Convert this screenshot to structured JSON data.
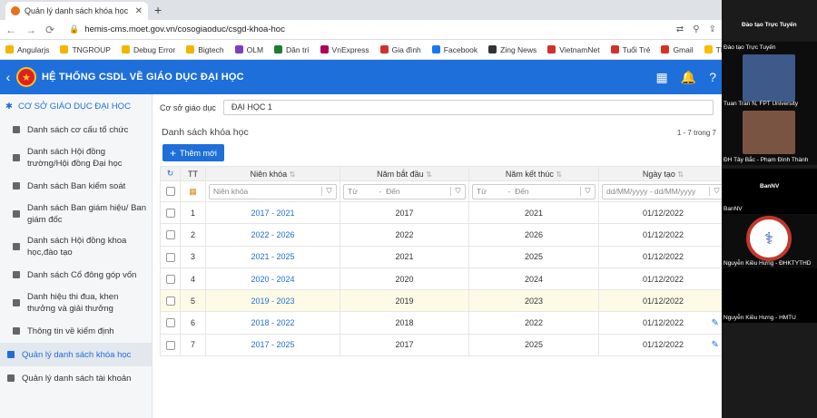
{
  "browser": {
    "tab_title": "Quản lý danh sách khóa học - H",
    "url": "hemis-cms.moet.gov.vn/cosogiaoduc/csgd-khoa-hoc",
    "bookmarks": [
      {
        "label": "Angularjs",
        "color": "#f4b400"
      },
      {
        "label": "TNGROUP",
        "color": "#f4b400"
      },
      {
        "label": "Debug Error",
        "color": "#f4b400"
      },
      {
        "label": "Bigtech",
        "color": "#f4b400"
      },
      {
        "label": "OLM",
        "color": "#7b3fbf"
      },
      {
        "label": "Dân trí",
        "color": "#1a7d2f"
      },
      {
        "label": "VnExpress",
        "color": "#b0005a"
      },
      {
        "label": "Gia đình",
        "color": "#d32f2f"
      },
      {
        "label": "Facebook",
        "color": "#1877f2"
      },
      {
        "label": "Zing News",
        "color": "#333333"
      },
      {
        "label": "VietnamNet",
        "color": "#d32f2f"
      },
      {
        "label": "Tuổi Trẻ",
        "color": "#d32f2f"
      },
      {
        "label": "Gmail",
        "color": "#d93025"
      },
      {
        "label": "TEAM",
        "color": "#fbbc04"
      }
    ]
  },
  "header": {
    "title": "HỆ THỐNG CSDL VỀ GIÁO DỤC ĐẠI HỌC",
    "color": "#1e6fd9"
  },
  "sidebar": {
    "heading": "CƠ SỞ GIÁO DỤC ĐẠI HỌC",
    "items": [
      {
        "label": "Danh sách cơ cấu tổ chức",
        "lines": 1
      },
      {
        "label": "Danh sách Hội đồng trường/Hội đồng Đại học",
        "lines": 2
      },
      {
        "label": "Danh sách Ban kiểm soát",
        "lines": 1
      },
      {
        "label": "Danh sách Ban giám hiệu/ Ban giám đốc",
        "lines": 2
      },
      {
        "label": "Danh sách Hội đồng khoa học,đào tạo",
        "lines": 2
      },
      {
        "label": "Danh sách Cổ đông góp vốn",
        "lines": 1
      },
      {
        "label": "Danh hiệu thi đua, khen thưởng và giải thưởng",
        "lines": 2
      },
      {
        "label": "Thông tin về kiểm định",
        "lines": 1
      }
    ],
    "active_item": "Quản lý danh sách khóa học",
    "bottom_item": "Quản lý danh sách tài khoản"
  },
  "main": {
    "filter_label": "Cơ sở giáo dục",
    "filter_value": "ĐẠI HỌC 1",
    "section_title": "Danh sách khóa học",
    "pager": "1 - 7 trong 7",
    "add_button": "Thêm mới",
    "columns": {
      "tt": "TT",
      "nien_khoa": "Niên khóa",
      "nam_bat_dau": "Năm bắt đầu",
      "nam_ket_thuc": "Năm kết thúc",
      "ngay_tao": "Ngày tạo"
    },
    "filters": {
      "nien_khoa_placeholder": "Niên khóa",
      "from": "Từ",
      "to": "Đến",
      "date_from": "dd/MM/yyyy",
      "date_to": "dd/MM/yyyy"
    },
    "rows": [
      {
        "tt": "1",
        "nien_khoa": "2017 - 2021",
        "start": "2017",
        "end": "2021",
        "created": "01/12/2022"
      },
      {
        "tt": "2",
        "nien_khoa": "2022 - 2026",
        "start": "2022",
        "end": "2026",
        "created": "01/12/2022"
      },
      {
        "tt": "3",
        "nien_khoa": "2021 - 2025",
        "start": "2021",
        "end": "2025",
        "created": "01/12/2022"
      },
      {
        "tt": "4",
        "nien_khoa": "2020 - 2024",
        "start": "2020",
        "end": "2024",
        "created": "01/12/2022"
      },
      {
        "tt": "5",
        "nien_khoa": "2019 - 2023",
        "start": "2019",
        "end": "2023",
        "created": "01/12/2022"
      },
      {
        "tt": "6",
        "nien_khoa": "2018 - 2022",
        "start": "2018",
        "end": "2022",
        "created": "01/12/2022"
      },
      {
        "tt": "7",
        "nien_khoa": "2017 - 2025",
        "start": "2017",
        "end": "2025",
        "created": "01/12/2022"
      }
    ],
    "highlight_row": 5
  },
  "video_panel": {
    "top_label": "Đào tạo Trực Tuyến",
    "tiles": [
      {
        "label_top": "Đào tạo Trực Tuyến",
        "label_bottom": "Tuan Tran N, FPT University"
      },
      {
        "label_bottom": "ĐH Tây Bắc - Phạm Đình Thành"
      },
      {
        "label_center": "BanNV",
        "label_bottom": "BanNV"
      },
      {
        "label_bottom": "Nguyễn Kiều Hưng - ĐHKTYTHD"
      },
      {
        "label_bottom": "Nguyễn Kiều Hưng - HMTU"
      }
    ]
  }
}
